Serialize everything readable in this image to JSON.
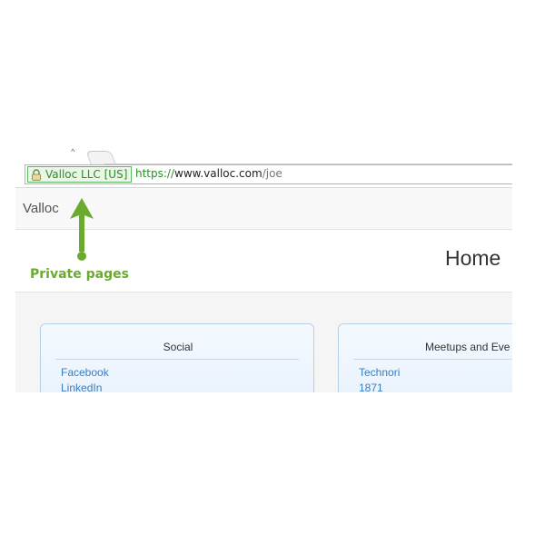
{
  "browser": {
    "ev_badge_text": "Valloc LLC [US]",
    "url_scheme": "https://",
    "url_host": "www.valloc.com",
    "url_path": "/joe",
    "colors": {
      "secure_green": "#2e8b2e",
      "badge_bg": "#eaf6e6"
    },
    "icons": {
      "ev_badge": "lock-icon"
    }
  },
  "site": {
    "brand": "Valloc",
    "page_title": "Home"
  },
  "annotation": {
    "label": "Private pages",
    "color": "#6aaa2e"
  },
  "panels": [
    {
      "title": "Social",
      "links": [
        "Facebook",
        "LinkedIn"
      ]
    },
    {
      "title": "Meetups and Eve",
      "links": [
        "Technori",
        "1871"
      ]
    }
  ]
}
